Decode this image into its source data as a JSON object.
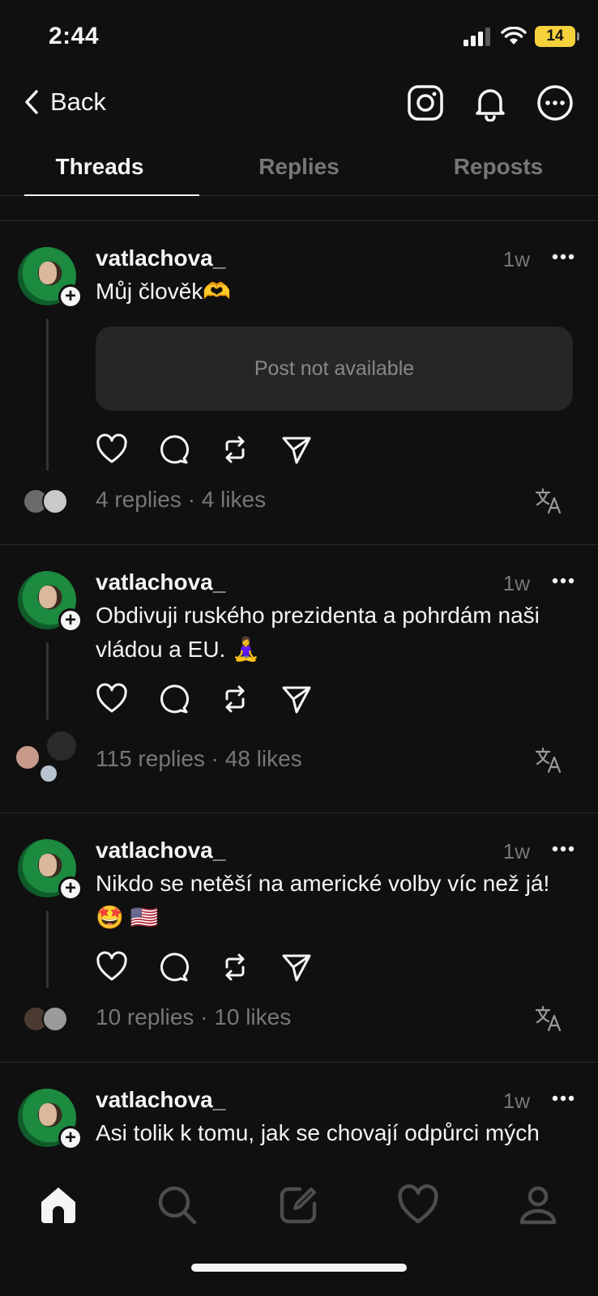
{
  "status_bar": {
    "time": "2:44",
    "battery": "14",
    "battery_color": "#f5d13c"
  },
  "nav": {
    "back_label": "Back",
    "icons": [
      "instagram-icon",
      "bell-icon",
      "more-circle-icon"
    ]
  },
  "tabs": [
    {
      "label": "Threads",
      "active": true
    },
    {
      "label": "Replies",
      "active": false
    },
    {
      "label": "Reposts",
      "active": false
    }
  ],
  "posts": [
    {
      "username": "vatlachova_",
      "time": "1w",
      "text": "Můj člověk🫶",
      "attachment": "Post not available",
      "stats": "4 replies · 4 likes"
    },
    {
      "username": "vatlachova_",
      "time": "1w",
      "text": "Obdivuji ruského prezidenta a pohrdám naši vládou a EU. 🧘‍♀️",
      "stats": "115 replies · 48 likes"
    },
    {
      "username": "vatlachova_",
      "time": "1w",
      "text": "Nikdo se netěší na americké volby víc než já!🤩 🇺🇸",
      "stats": "10 replies · 10 likes"
    },
    {
      "username": "vatlachova_",
      "time": "1w",
      "text": "Asi tolik k tomu, jak se chovají odpůrci mých"
    }
  ],
  "bottom_nav": [
    "home-icon",
    "search-icon",
    "compose-icon",
    "activity-heart-icon",
    "profile-icon"
  ],
  "colors": {
    "background": "#101010",
    "text": "#f3f5f7",
    "muted": "#777777",
    "card": "#262626"
  }
}
